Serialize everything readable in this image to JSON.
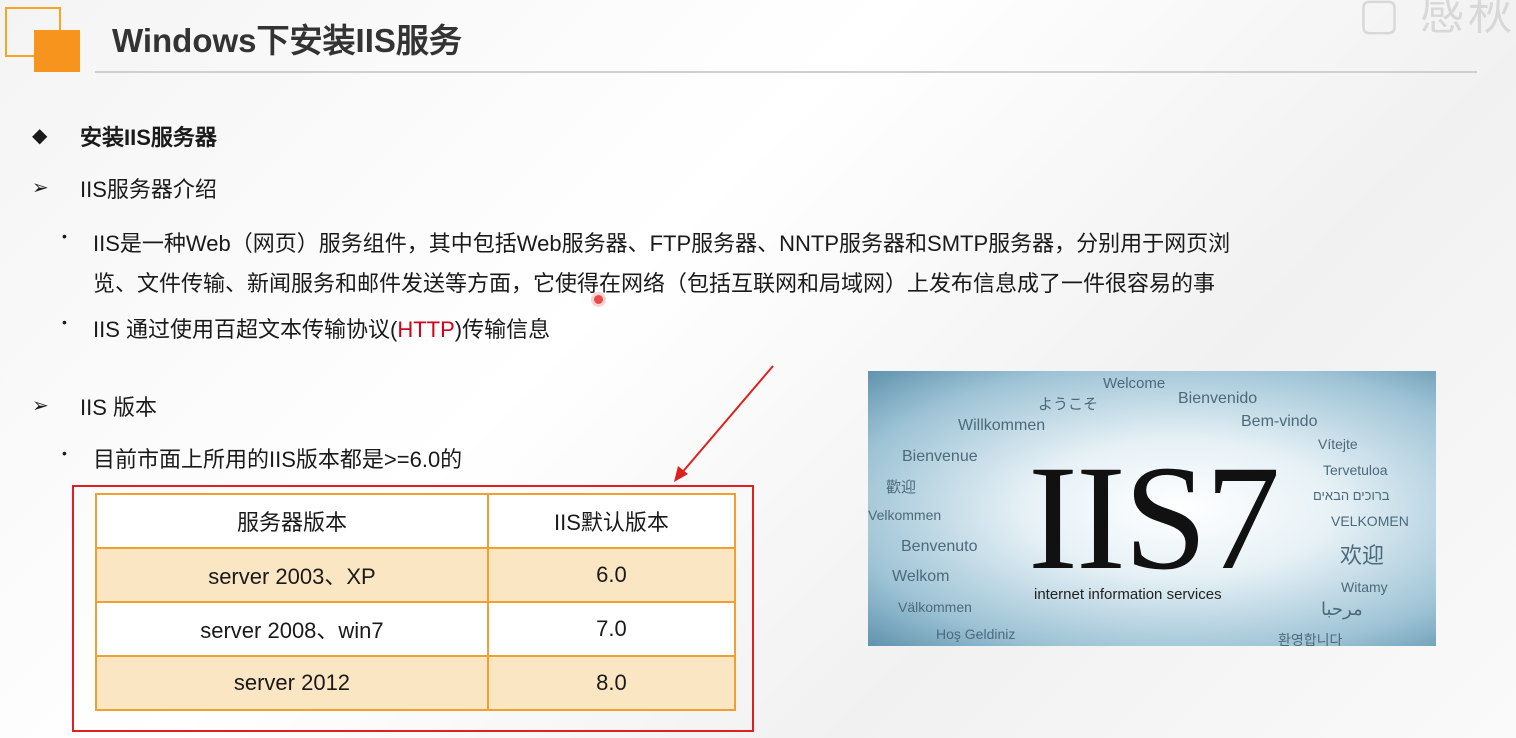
{
  "header": {
    "title": "Windows下安装IIS服务",
    "watermark": "▢ 感秋"
  },
  "content": {
    "section1": {
      "bullet": "◆",
      "text": "安装IIS服务器"
    },
    "section2": {
      "bullet": "➢",
      "text": "IIS服务器介绍"
    },
    "intro_line1": "IIS是一种Web（网页）服务组件，其中包括Web服务器、FTP服务器、NNTP服务器和SMTP服务器，分别用于网页浏",
    "intro_line2": "览、文件传输、新闻服务和邮件发送等方面，它使得在网络（包括互联网和局域网）上发布信息成了一件很容易的事",
    "http_prefix": "IIS 通过使用百超文本传输协议(",
    "http_red": "HTTP",
    "http_suffix": ")传输信息",
    "section3": {
      "bullet": "➢",
      "text": "IIS 版本"
    },
    "version_note": "目前市面上所用的IIS版本都是>=6.0的",
    "dot": "•"
  },
  "table": {
    "headers": [
      "服务器版本",
      "IIS默认版本"
    ],
    "rows": [
      [
        "server 2003、XP",
        "6.0"
      ],
      [
        "server 2008、win7",
        "7.0"
      ],
      [
        "server 2012",
        "8.0"
      ]
    ]
  },
  "iis_image": {
    "logo": "IIS7",
    "subtitle": "internet information services",
    "words": [
      "Welcome",
      "ようこそ",
      "Bienvenido",
      "Willkommen",
      "Bem-vindo",
      "Vítejte",
      "Bienvenue",
      "Tervetuloa",
      "歡迎",
      "ברוכים הבאים",
      "Velkommen",
      "VELKOMEN",
      "Benvenuto",
      "欢迎",
      "Welkom",
      "Witamy",
      "Välkommen",
      "مرحبا",
      "Hoş Geldiniz",
      "환영합니다"
    ]
  }
}
